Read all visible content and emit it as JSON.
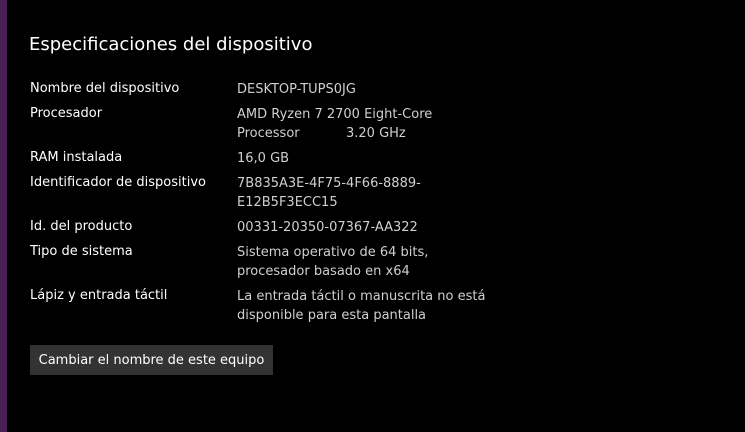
{
  "section_title": "Especificaciones del dispositivo",
  "specs": {
    "device_name": {
      "label": "Nombre del dispositivo",
      "value": "DESKTOP-TUPS0JG"
    },
    "processor": {
      "label": "Procesador",
      "value_line1": "AMD Ryzen 7 2700 Eight-Core",
      "value_line2_name": "Processor",
      "value_line2_speed": "3.20 GHz"
    },
    "ram": {
      "label": "RAM instalada",
      "value": "16,0 GB"
    },
    "device_id": {
      "label": "Identificador de dispositivo",
      "value_line1": "7B835A3E-4F75-4F66-8889-",
      "value_line2": "E12B5F3ECC15"
    },
    "product_id": {
      "label": "Id. del producto",
      "value": "00331-20350-07367-AA322"
    },
    "system_type": {
      "label": "Tipo de sistema",
      "value_line1": "Sistema operativo de 64 bits,",
      "value_line2": "procesador basado en x64"
    },
    "pen_touch": {
      "label": "Lápiz y entrada táctil",
      "value_line1": "La entrada táctil o manuscrita no está",
      "value_line2": "disponible para esta pantalla"
    }
  },
  "rename_button_label": "Cambiar el nombre de este equipo",
  "colors": {
    "background": "#000000",
    "accent_strip": "#4a1f52",
    "label_text": "#ffffff",
    "value_text": "#cfcfcf",
    "button_bg": "#333333"
  }
}
